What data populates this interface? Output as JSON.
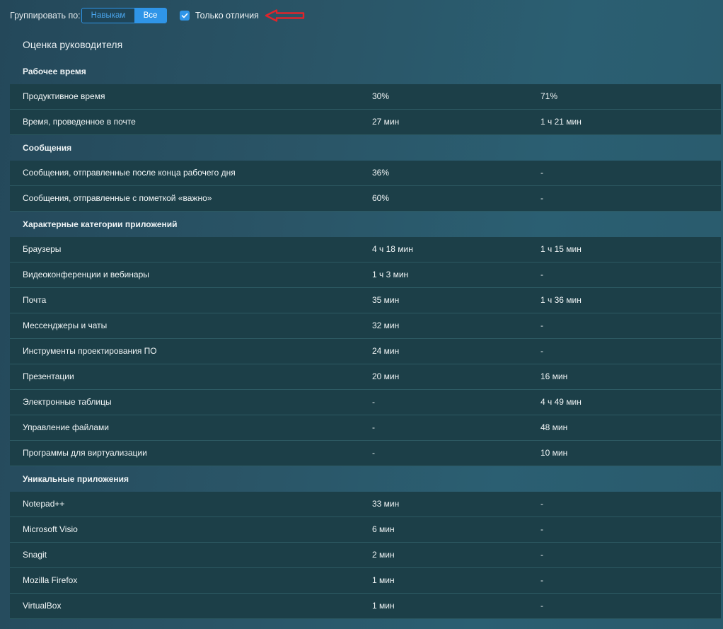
{
  "toolbar": {
    "group_by_label": "Группировать по:",
    "group_options": [
      "Навыкам",
      "Все"
    ],
    "selected_group": "Все",
    "only_differences_label": "Только отличия",
    "only_differences_checked": true
  },
  "colors": {
    "accent": "#2f95e8",
    "row_bg": "#1c3f48",
    "annotation_arrow": "#e0242b"
  },
  "section": {
    "title": "Оценка руководителя"
  },
  "groups": [
    {
      "title": "Рабочее время",
      "rows": [
        [
          "Продуктивное время",
          "30%",
          "71%"
        ],
        [
          "Время, проведенное в почте",
          "27 мин",
          "1 ч 21 мин"
        ]
      ]
    },
    {
      "title": "Сообщения",
      "rows": [
        [
          "Сообщения, отправленные после конца рабочего дня",
          "36%",
          "-"
        ],
        [
          "Сообщения, отправленные с пометкой «важно»",
          "60%",
          "-"
        ]
      ]
    },
    {
      "title": "Характерные категории приложений",
      "rows": [
        [
          "Браузеры",
          "4 ч 18 мин",
          "1 ч 15 мин"
        ],
        [
          "Видеоконференции и вебинары",
          "1 ч 3 мин",
          "-"
        ],
        [
          "Почта",
          "35 мин",
          "1 ч 36 мин"
        ],
        [
          "Мессенджеры и чаты",
          "32 мин",
          "-"
        ],
        [
          "Инструменты проектирования ПО",
          "24 мин",
          "-"
        ],
        [
          "Презентации",
          "20 мин",
          "16 мин"
        ],
        [
          "Электронные таблицы",
          "-",
          "4 ч 49 мин"
        ],
        [
          "Управление файлами",
          "-",
          "48 мин"
        ],
        [
          "Программы для виртуализации",
          "-",
          "10 мин"
        ]
      ]
    },
    {
      "title": "Уникальные приложения",
      "rows": [
        [
          "Notepad++",
          "33 мин",
          "-"
        ],
        [
          "Microsoft Visio",
          "6 мин",
          "-"
        ],
        [
          "Snagit",
          "2 мин",
          "-"
        ],
        [
          "Mozilla Firefox",
          "1 мин",
          "-"
        ],
        [
          "VirtualBox",
          "1 мин",
          "-"
        ]
      ]
    }
  ]
}
